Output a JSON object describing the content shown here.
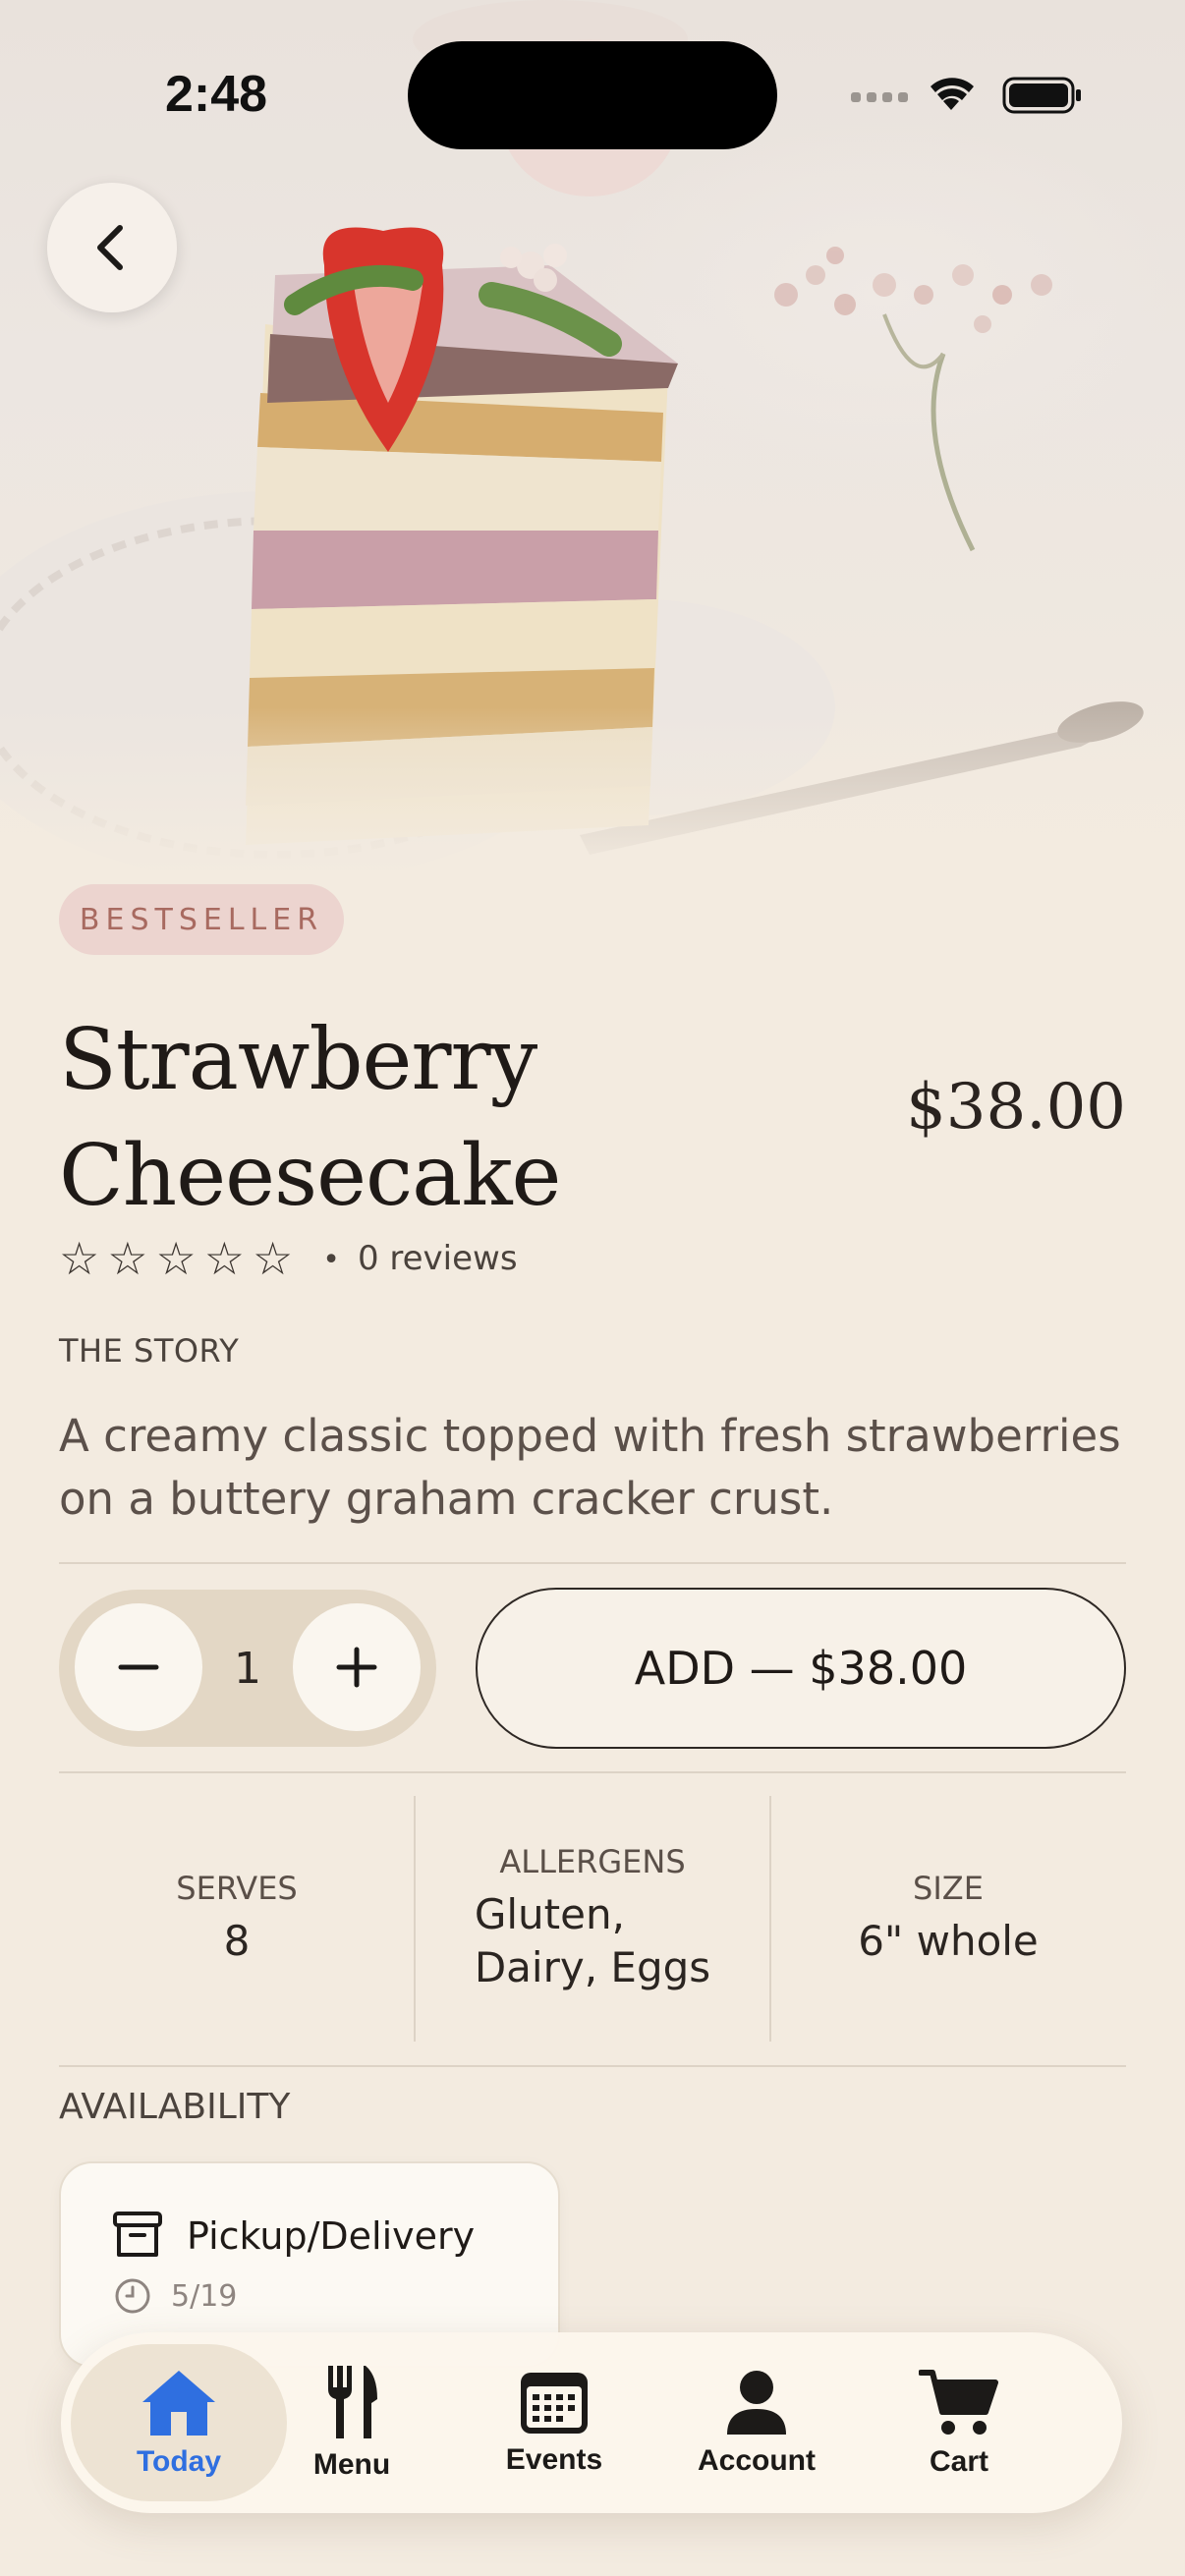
{
  "status_bar": {
    "time": "2:48"
  },
  "product": {
    "badge": "BESTSELLER",
    "title_line1": "Strawberry",
    "title_line2": "Cheesecake",
    "price": "$38.00",
    "rating_stars": 0,
    "reviews_text": "0 reviews",
    "story_label": "THE STORY",
    "story": "A creamy classic topped with fresh strawberries on a buttery graham cracker crust."
  },
  "order": {
    "quantity": "1",
    "add_label": "ADD — $38.00"
  },
  "info": {
    "serves_label": "SERVES",
    "serves_value": "8",
    "allergens_label": "ALLERGENS",
    "allergens_value_line1": "Gluten,",
    "allergens_value_line2": "Dairy, Eggs",
    "size_label": "SIZE",
    "size_value": "6\" whole"
  },
  "availability": {
    "label": "AVAILABILITY",
    "card_title": "Pickup/Delivery",
    "card_date": "5/19"
  },
  "tabbar": {
    "active": "Today",
    "accent": "#2f6fe0",
    "items": [
      {
        "label": "Today",
        "icon": "home-icon"
      },
      {
        "label": "Menu",
        "icon": "fork-knife-icon"
      },
      {
        "label": "Events",
        "icon": "calendar-icon"
      },
      {
        "label": "Account",
        "icon": "person-icon"
      },
      {
        "label": "Cart",
        "icon": "cart-icon"
      }
    ]
  },
  "colors": {
    "background": "#f3ebe0",
    "badge_bg": "#ecd4cf",
    "badge_text": "#a86a60"
  }
}
